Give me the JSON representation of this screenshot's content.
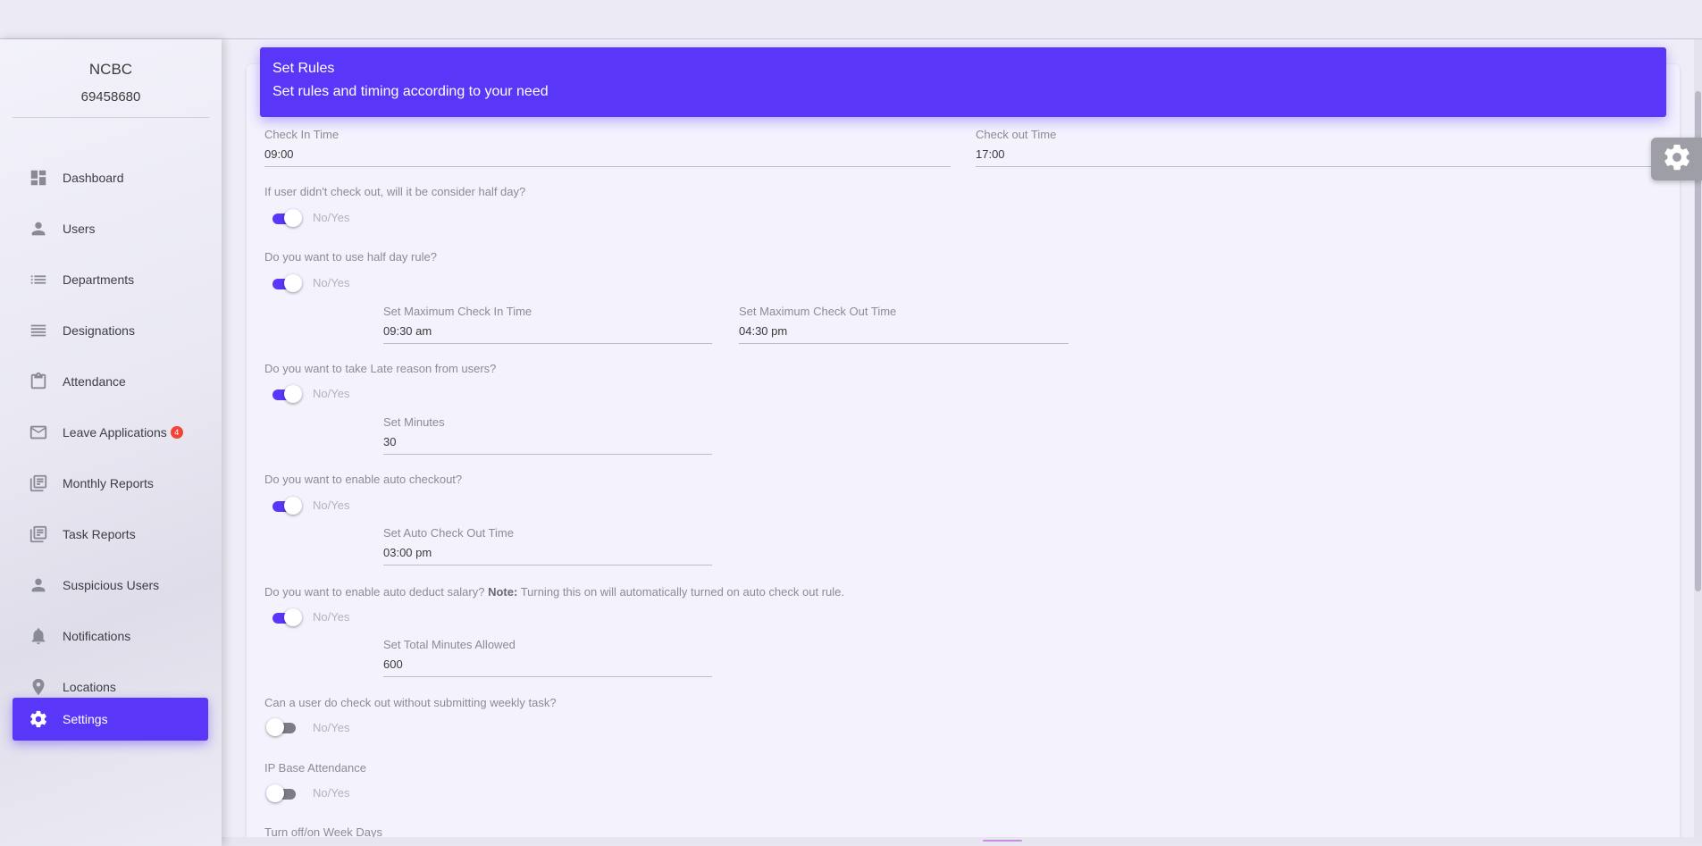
{
  "org": {
    "name": "NCBC",
    "code": "69458680"
  },
  "sidebar": {
    "items": [
      {
        "label": "Dashboard",
        "icon": "dashboard-icon"
      },
      {
        "label": "Users",
        "icon": "user-icon"
      },
      {
        "label": "Departments",
        "icon": "list-icon"
      },
      {
        "label": "Designations",
        "icon": "lines-icon"
      },
      {
        "label": "Attendance",
        "icon": "clipboard-icon"
      },
      {
        "label": "Leave Applications",
        "icon": "mail-icon",
        "badge": "4"
      },
      {
        "label": "Monthly Reports",
        "icon": "library-books-icon"
      },
      {
        "label": "Task Reports",
        "icon": "library-books-icon"
      },
      {
        "label": "Suspicious Users",
        "icon": "user-icon"
      },
      {
        "label": "Notifications",
        "icon": "bell-icon"
      },
      {
        "label": "Locations",
        "icon": "location-pin-icon"
      },
      {
        "label": "Settings",
        "icon": "gear-icon",
        "active": true
      }
    ]
  },
  "header": {
    "title": "Set Rules",
    "subtitle": "Set rules and timing according to your need"
  },
  "form": {
    "check_in": {
      "label": "Check In Time",
      "value": "09:00"
    },
    "check_out": {
      "label": "Check out Time",
      "value": "17:00"
    },
    "toggle_label": "No/Yes",
    "q_half_day_no_checkout": {
      "text": "If user didn't check out, will it be consider half day?",
      "on": true
    },
    "q_half_day_rule": {
      "text": "Do you want to use half day rule?",
      "on": true
    },
    "max_check_in": {
      "label": "Set Maximum Check In Time",
      "value": "09:30 am"
    },
    "max_check_out": {
      "label": "Set Maximum Check Out Time",
      "value": "04:30 pm"
    },
    "q_late_reason": {
      "text": "Do you want to take Late reason from users?",
      "on": true
    },
    "set_minutes": {
      "label": "Set Minutes",
      "value": "30"
    },
    "q_auto_checkout": {
      "text": "Do you want to enable auto checkout?",
      "on": true
    },
    "auto_checkout_time": {
      "label": "Set Auto Check Out Time",
      "value": "03:00 pm"
    },
    "q_auto_deduct": {
      "text": "Do you want to enable auto deduct salary?",
      "note_label": "Note:",
      "note": "Turning this on will automatically turned on auto check out rule.",
      "on": true
    },
    "total_minutes": {
      "label": "Set Total Minutes Allowed",
      "value": "600"
    },
    "q_weekly_task": {
      "text": "Can a user do check out without submitting weekly task?",
      "on": false
    },
    "q_ip_attendance": {
      "text": "IP Base Attendance",
      "on": false
    },
    "q_week_days": {
      "text": "Turn off/on Week Days"
    }
  },
  "colors": {
    "accent": "#5a37f8",
    "badge": "#f44336"
  }
}
